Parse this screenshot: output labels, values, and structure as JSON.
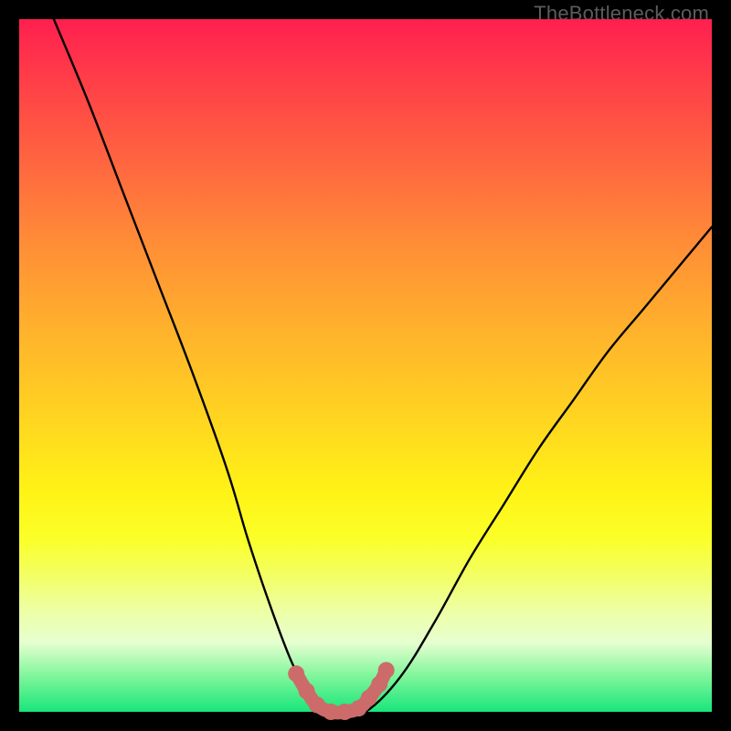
{
  "watermark": "TheBottleneck.com",
  "colors": {
    "frame": "#000000",
    "gradient_top": "#ff1f4f",
    "gradient_bottom": "#18e67a",
    "curve": "#000000",
    "markers": "#cc6b69"
  },
  "chart_data": {
    "type": "line",
    "title": "",
    "xlabel": "",
    "ylabel": "",
    "xlim": [
      0,
      100
    ],
    "ylim": [
      0,
      100
    ],
    "series": [
      {
        "name": "bottleneck-curve",
        "x": [
          5,
          10,
          15,
          20,
          25,
          30,
          33,
          36,
          39,
          41,
          43,
          45,
          47,
          50,
          55,
          60,
          65,
          70,
          75,
          80,
          85,
          90,
          95,
          100
        ],
        "values": [
          100,
          88,
          75,
          62,
          49,
          35,
          25,
          16,
          8,
          4,
          1,
          0,
          0,
          0,
          5,
          13,
          22,
          30,
          38,
          45,
          52,
          58,
          64,
          70
        ]
      }
    ],
    "markers": {
      "name": "highlight-points",
      "x": [
        40,
        41.5,
        43,
        45,
        47,
        49,
        50.5,
        52,
        53
      ],
      "values": [
        5.5,
        3,
        1,
        0,
        0,
        0.5,
        2,
        4,
        6
      ]
    }
  }
}
